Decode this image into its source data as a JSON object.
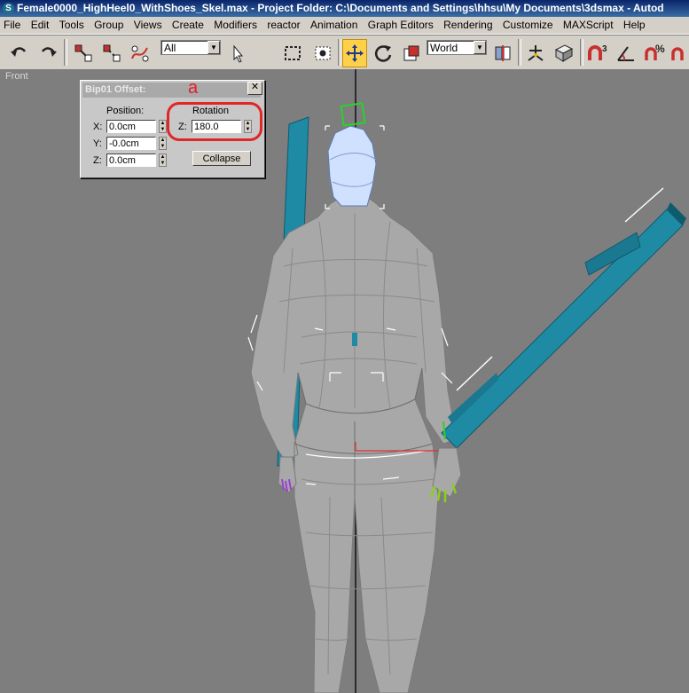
{
  "window": {
    "title": "Female0000_HighHeel0_WithShoes_Skel.max    - Project Folder: C:\\Documents and Settings\\hhsu\\My Documents\\3dsmax    - Autod"
  },
  "menu": [
    "File",
    "Edit",
    "Tools",
    "Group",
    "Views",
    "Create",
    "Modifiers",
    "reactor",
    "Animation",
    "Graph Editors",
    "Rendering",
    "Customize",
    "MAXScript",
    "Help"
  ],
  "toolbar": {
    "selection_filter": "All",
    "reference_coord": "World",
    "icons": [
      "undo-icon",
      "redo-icon",
      "select-and-link-icon",
      "unlink-icon",
      "bind-to-space-warp-icon",
      "select-object-icon",
      "rectangular-selection-icon",
      "window-crossing-icon",
      "select-and-move-icon",
      "select-and-rotate-icon",
      "select-and-scale-icon",
      "use-pivot-center-icon",
      "manipulate-icon",
      "keyboard-shortcut-icon",
      "snaps-toggle-icon",
      "angle-snap-icon",
      "percent-snap-icon",
      "spinner-snap-icon"
    ],
    "snap_label": "3",
    "percent_label": "%"
  },
  "viewport": {
    "label": "Front"
  },
  "dialog": {
    "title": "Bip01 Offset:",
    "position_label": "Position:",
    "rotation_label": "Rotation",
    "x_label": "X:",
    "x_value": "0.0cm",
    "y_label": "Y:",
    "y_value": "-0.0cm",
    "z_label": "Z:",
    "z_value": "0.0cm",
    "rot_z_label": "Z:",
    "rot_z_value": "180.0",
    "collapse_label": "Collapse",
    "close_glyph": "✕"
  },
  "annotation": {
    "marker": "a",
    "color": "#e0202a"
  },
  "colors": {
    "viewport_bg": "#7e7e7e",
    "bone": "#1e8aa4",
    "mesh": "#a8a8a8",
    "head_selected": "#cfe1ff"
  }
}
